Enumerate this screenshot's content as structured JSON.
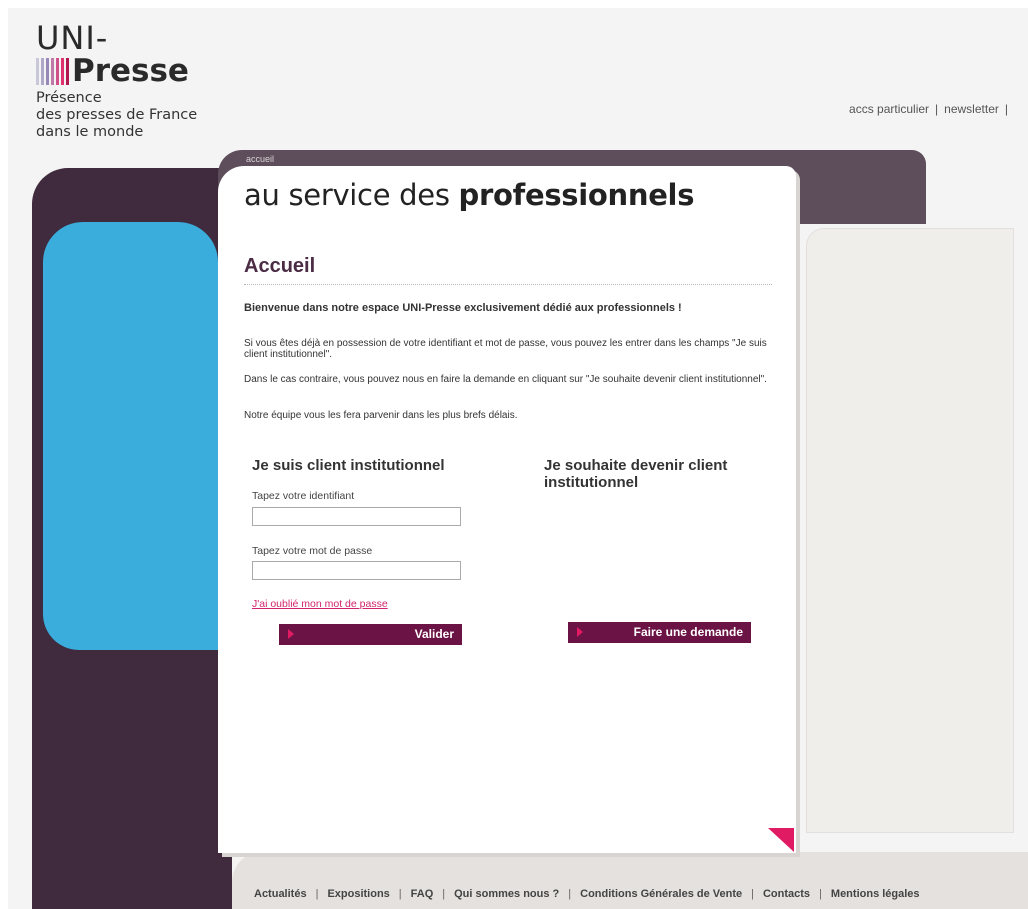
{
  "logo": {
    "line1": "UNI-",
    "line2": "Presse",
    "tagline1": "Présence",
    "tagline2": "des presses de France",
    "tagline3": "dans le monde",
    "bar_colors": [
      "#c8c8d8",
      "#b0a8c8",
      "#9888b8",
      "#c07aa8",
      "#d0508a",
      "#e0306e",
      "#b01850"
    ]
  },
  "top_links": {
    "particulier": "accs particulier",
    "newsletter": "newsletter",
    "separator": "|"
  },
  "breadcrumb": "accueil",
  "headline": {
    "light": "au service des ",
    "bold": "professionnels"
  },
  "main": {
    "title": "Accueil",
    "intro": "Bienvenue dans notre espace UNI-Presse exclusivement dédié aux professionnels !",
    "p1": "Si vous êtes déjà en possession de votre identifiant et mot de passe, vous pouvez les entrer dans les champs \"Je suis client institutionnel\".",
    "p2": "Dans le cas contraire, vous pouvez nous en faire la demande en cliquant sur \"Je souhaite devenir client institutionnel\".",
    "p3": "Notre équipe vous les fera parvenir dans les plus brefs délais."
  },
  "login": {
    "title": "Je suis client institutionnel",
    "id_label": "Tapez votre identifiant",
    "id_value": "",
    "pw_label": "Tapez votre mot de passe",
    "pw_value": "",
    "forgot": "J'ai oublié mon mot de passe",
    "submit": "Valider"
  },
  "signup": {
    "title": "Je souhaite devenir client institutionnel",
    "submit": "Faire une demande"
  },
  "footer": {
    "separator": "|",
    "links": [
      "Actualités",
      "Expositions",
      "FAQ",
      "Qui sommes nous ?",
      "Conditions Générales de Vente",
      "Contacts",
      "Mentions légales"
    ]
  },
  "colors": {
    "dark_plum": "#3f2a3e",
    "blue": "#3aaddc",
    "button": "#6c1346",
    "accent_pink": "#e01b63",
    "link_pink": "#d0256c"
  }
}
